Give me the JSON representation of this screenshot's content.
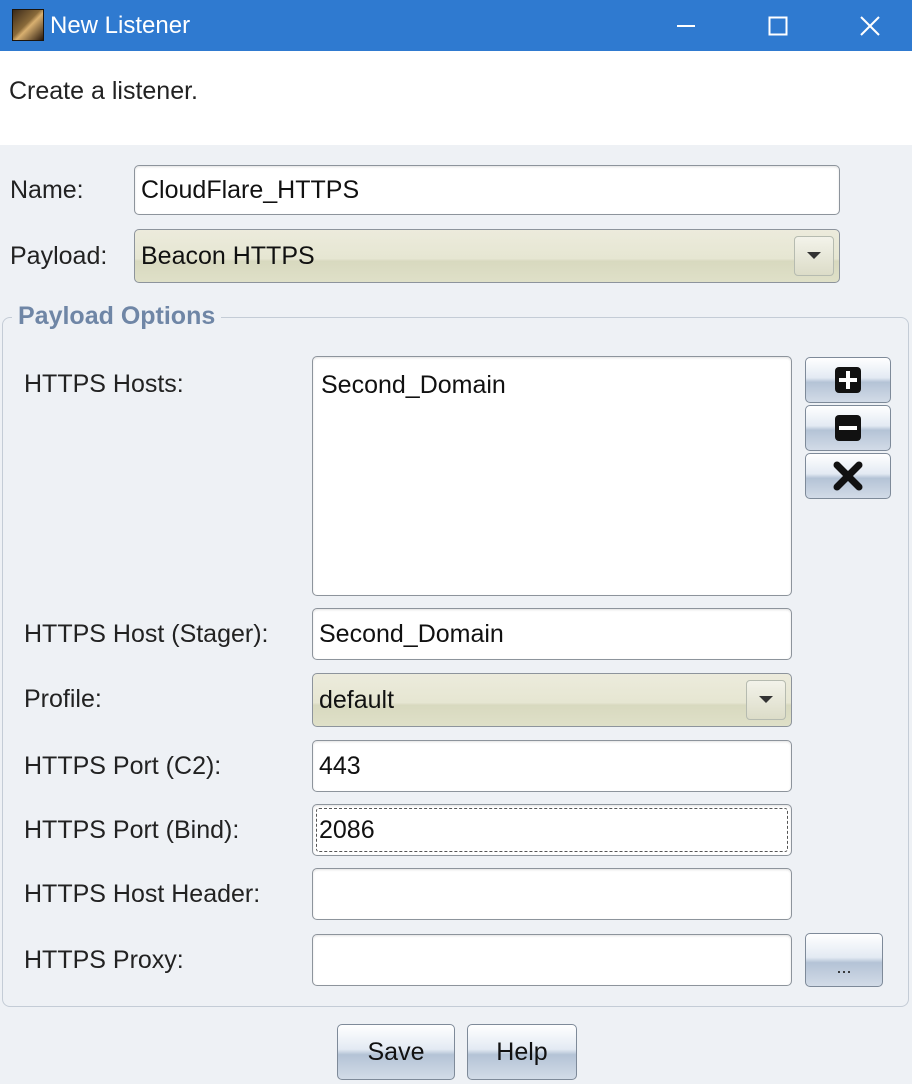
{
  "window": {
    "title": "New Listener",
    "controls": {
      "minimize": "minimize-icon",
      "maximize": "maximize-icon",
      "close": "close-icon"
    }
  },
  "banner": {
    "text": "Create a listener."
  },
  "form": {
    "name_label": "Name:",
    "name_value": "CloudFlare_HTTPS",
    "payload_label": "Payload:",
    "payload_value": "Beacon HTTPS"
  },
  "payload_options": {
    "title": "Payload Options",
    "hosts_label": "HTTPS Hosts:",
    "hosts": [
      "Second_Domain"
    ],
    "host_buttons": [
      "plus-icon",
      "minus-icon",
      "remove-x-icon"
    ],
    "stager_label": "HTTPS Host (Stager):",
    "stager_value": "Second_Domain",
    "profile_label": "Profile:",
    "profile_value": "default",
    "port_c2_label": "HTTPS Port (C2):",
    "port_c2_value": "443",
    "port_bind_label": "HTTPS Port (Bind):",
    "port_bind_value": "2086",
    "host_header_label": "HTTPS Host Header:",
    "host_header_value": "",
    "proxy_label": "HTTPS Proxy:",
    "proxy_value": "",
    "proxy_button": "..."
  },
  "buttons": {
    "save": "Save",
    "help": "Help"
  },
  "colors": {
    "titlebar": "#2f7ad0",
    "group_title": "#6f86a6",
    "combo_bg": "#e6e6d2"
  }
}
